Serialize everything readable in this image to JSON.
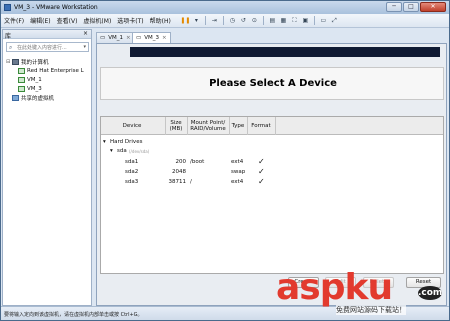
{
  "window": {
    "title": "VM_3 - VMware Workstation",
    "min": "─",
    "max": "□",
    "close": "✕"
  },
  "menu": [
    "文件(F)",
    "编辑(E)",
    "查看(V)",
    "虚拟机(M)",
    "选项卡(T)",
    "帮助(H)"
  ],
  "sidebar": {
    "header": "库",
    "close": "×",
    "search_placeholder": "在此处键入内容进行...",
    "tree": [
      {
        "label": "我的计算机",
        "icon": "computer-icon",
        "expander": "⊟"
      },
      {
        "label": "Red Hat Enterprise L",
        "icon": "vm-icon"
      },
      {
        "label": "VM_1",
        "icon": "vm-icon"
      },
      {
        "label": "VM_3",
        "icon": "vm-icon"
      },
      {
        "label": "共享的虚拟机",
        "icon": "shared-vm-icon"
      }
    ]
  },
  "tabs": [
    {
      "label": "VM_1",
      "close": "×"
    },
    {
      "label": "VM_3",
      "close": "×"
    }
  ],
  "installer": {
    "heading": "Please Select A Device",
    "columns": [
      "Device",
      "Size\n(MB)",
      "Mount Point/\nRAID/Volume",
      "Type",
      "Format"
    ],
    "group": "Hard Drives",
    "disk": {
      "name": "sda",
      "sub": "(/dev/sda)"
    },
    "partitions": [
      {
        "name": "sda1",
        "size": "200",
        "mount": "/boot",
        "type": "ext4",
        "format": "✓"
      },
      {
        "name": "sda2",
        "size": "2048",
        "mount": "",
        "type": "swap",
        "format": "✓"
      },
      {
        "name": "sda3",
        "size": "38711",
        "mount": "/",
        "type": "ext4",
        "format": "✓"
      }
    ],
    "buttons": {
      "create": "Create",
      "edit": "Edit",
      "delete": "Delete",
      "reset": "Reset"
    }
  },
  "statusbar": {
    "text": "要将输入定向到该虚拟机，请在虚拟机内部单击或按 Ctrl+G。"
  },
  "watermark": {
    "logo": "asp",
    "logo2": "ku",
    "dotcom": ".com",
    "sub": "免费网站源码下载站！"
  }
}
